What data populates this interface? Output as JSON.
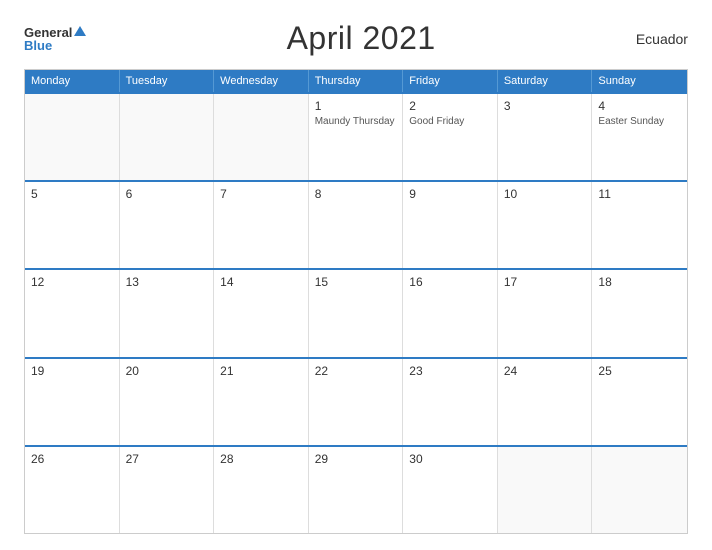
{
  "header": {
    "logo_general": "General",
    "logo_blue": "Blue",
    "title": "April 2021",
    "country": "Ecuador"
  },
  "calendar": {
    "days_of_week": [
      "Monday",
      "Tuesday",
      "Wednesday",
      "Thursday",
      "Friday",
      "Saturday",
      "Sunday"
    ],
    "weeks": [
      [
        {
          "day": "",
          "event": "",
          "empty": true
        },
        {
          "day": "",
          "event": "",
          "empty": true
        },
        {
          "day": "",
          "event": "",
          "empty": true
        },
        {
          "day": "1",
          "event": "Maundy Thursday",
          "empty": false
        },
        {
          "day": "2",
          "event": "Good Friday",
          "empty": false
        },
        {
          "day": "3",
          "event": "",
          "empty": false
        },
        {
          "day": "4",
          "event": "Easter Sunday",
          "empty": false
        }
      ],
      [
        {
          "day": "5",
          "event": "",
          "empty": false
        },
        {
          "day": "6",
          "event": "",
          "empty": false
        },
        {
          "day": "7",
          "event": "",
          "empty": false
        },
        {
          "day": "8",
          "event": "",
          "empty": false
        },
        {
          "day": "9",
          "event": "",
          "empty": false
        },
        {
          "day": "10",
          "event": "",
          "empty": false
        },
        {
          "day": "11",
          "event": "",
          "empty": false
        }
      ],
      [
        {
          "day": "12",
          "event": "",
          "empty": false
        },
        {
          "day": "13",
          "event": "",
          "empty": false
        },
        {
          "day": "14",
          "event": "",
          "empty": false
        },
        {
          "day": "15",
          "event": "",
          "empty": false
        },
        {
          "day": "16",
          "event": "",
          "empty": false
        },
        {
          "day": "17",
          "event": "",
          "empty": false
        },
        {
          "day": "18",
          "event": "",
          "empty": false
        }
      ],
      [
        {
          "day": "19",
          "event": "",
          "empty": false
        },
        {
          "day": "20",
          "event": "",
          "empty": false
        },
        {
          "day": "21",
          "event": "",
          "empty": false
        },
        {
          "day": "22",
          "event": "",
          "empty": false
        },
        {
          "day": "23",
          "event": "",
          "empty": false
        },
        {
          "day": "24",
          "event": "",
          "empty": false
        },
        {
          "day": "25",
          "event": "",
          "empty": false
        }
      ],
      [
        {
          "day": "26",
          "event": "",
          "empty": false
        },
        {
          "day": "27",
          "event": "",
          "empty": false
        },
        {
          "day": "28",
          "event": "",
          "empty": false
        },
        {
          "day": "29",
          "event": "",
          "empty": false
        },
        {
          "day": "30",
          "event": "",
          "empty": false
        },
        {
          "day": "",
          "event": "",
          "empty": true
        },
        {
          "day": "",
          "event": "",
          "empty": true
        }
      ]
    ]
  }
}
